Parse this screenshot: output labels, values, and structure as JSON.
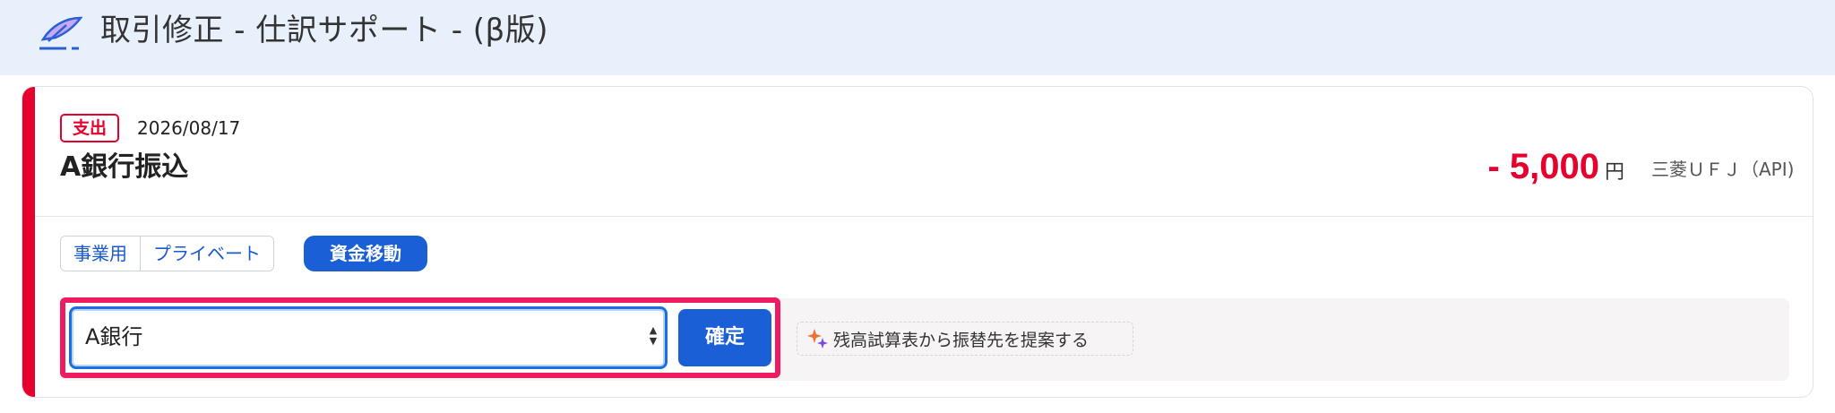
{
  "header": {
    "title": "取引修正 - 仕訳サポート - (β版)",
    "icon": "quill-pen-icon",
    "background_color": "#e8f0fb"
  },
  "transaction": {
    "type_badge": "支出",
    "date": "2026/08/17",
    "title": "A銀行振込",
    "amount": "- 5,000",
    "currency_unit": "円",
    "account": "三菱ＵＦＪ（API)",
    "accent_color": "#e6002d"
  },
  "category": {
    "segments": [
      "事業用",
      "プライベート"
    ],
    "active_pill": "資金移動"
  },
  "transfer": {
    "selected_account": "A銀行",
    "confirm_label": "確定",
    "suggest_label": "残高試算表から振替先を提案する",
    "primary_color": "#1a5fd6",
    "highlight_color": "#ef1b60"
  }
}
